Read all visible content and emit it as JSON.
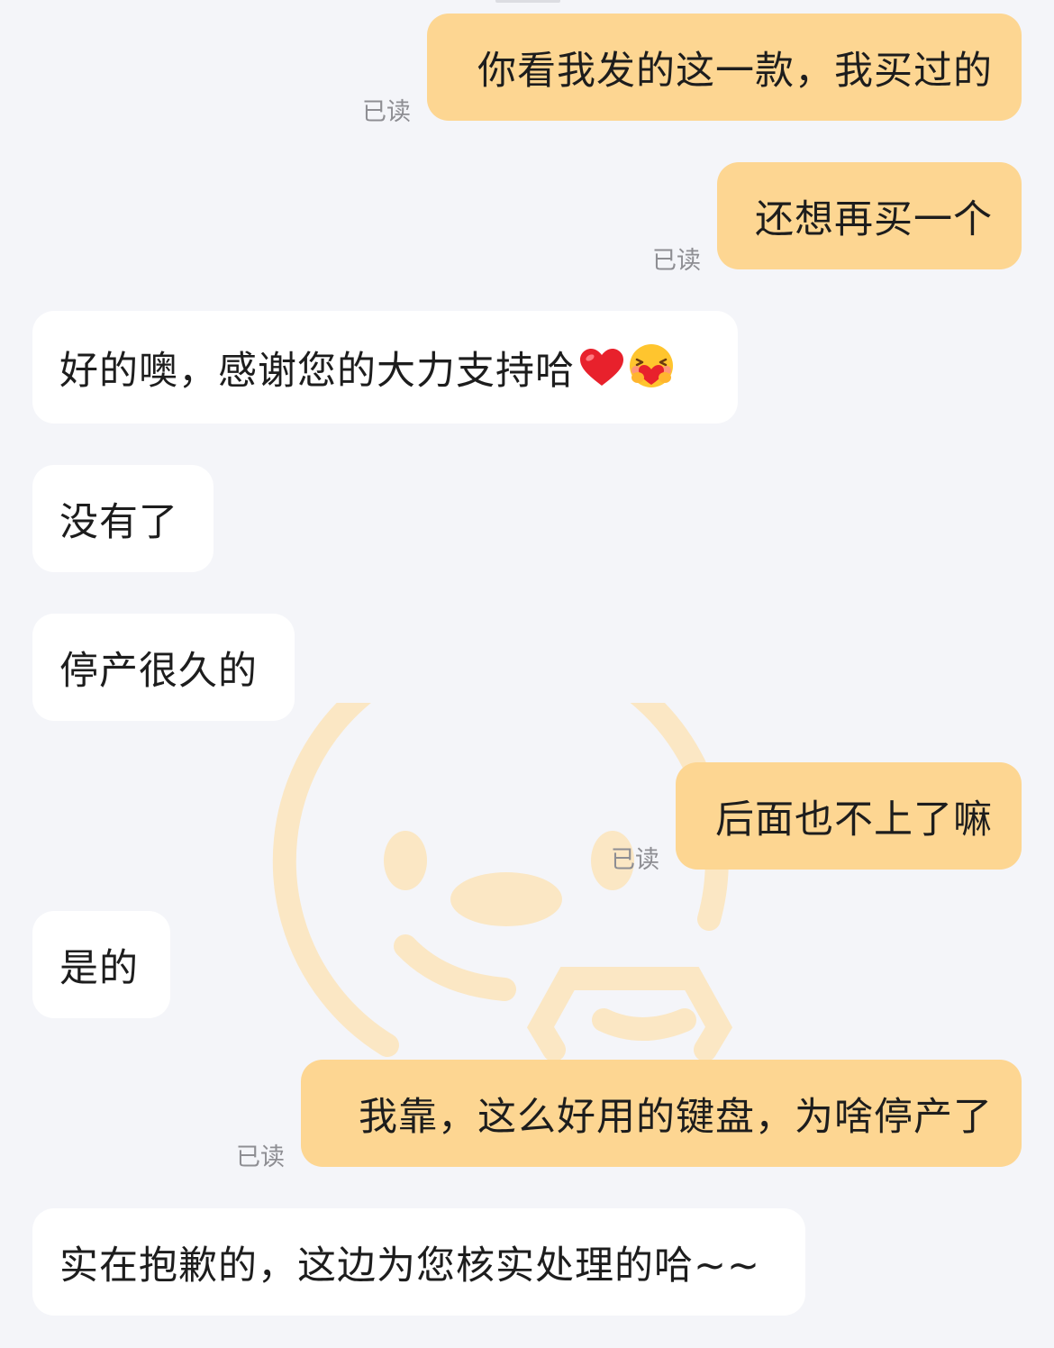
{
  "chat": {
    "read_label": "已读",
    "messages": [
      {
        "sender": "me",
        "text": "你看我发的这一款，我买过的",
        "status": "已读"
      },
      {
        "sender": "me",
        "text": "还想再买一个",
        "status": "已读"
      },
      {
        "sender": "them",
        "text": "好的噢，感谢您的大力支持哈",
        "emojis": [
          "red-heart-emoji",
          "hugging-heart-face-emoji"
        ]
      },
      {
        "sender": "them",
        "text": "没有了"
      },
      {
        "sender": "them",
        "text": "停产很久的"
      },
      {
        "sender": "me",
        "text": "后面也不上了嘛",
        "status": "已读"
      },
      {
        "sender": "them",
        "text": "是的"
      },
      {
        "sender": "me",
        "text": "我靠，这么好用的键盘，为啥停产了",
        "status": "已读"
      },
      {
        "sender": "them",
        "text": "实在抱歉的，这边为您核实处理的哈~~"
      }
    ]
  },
  "colors": {
    "background": "#f4f5f9",
    "outgoing_bubble": "#fdd692",
    "incoming_bubble": "#ffffff",
    "text": "#1d1d1d",
    "read_status": "#8e8e93",
    "watermark": "#fbe7c4"
  },
  "watermark": {
    "icon": "smiley-mascot-watermark"
  }
}
